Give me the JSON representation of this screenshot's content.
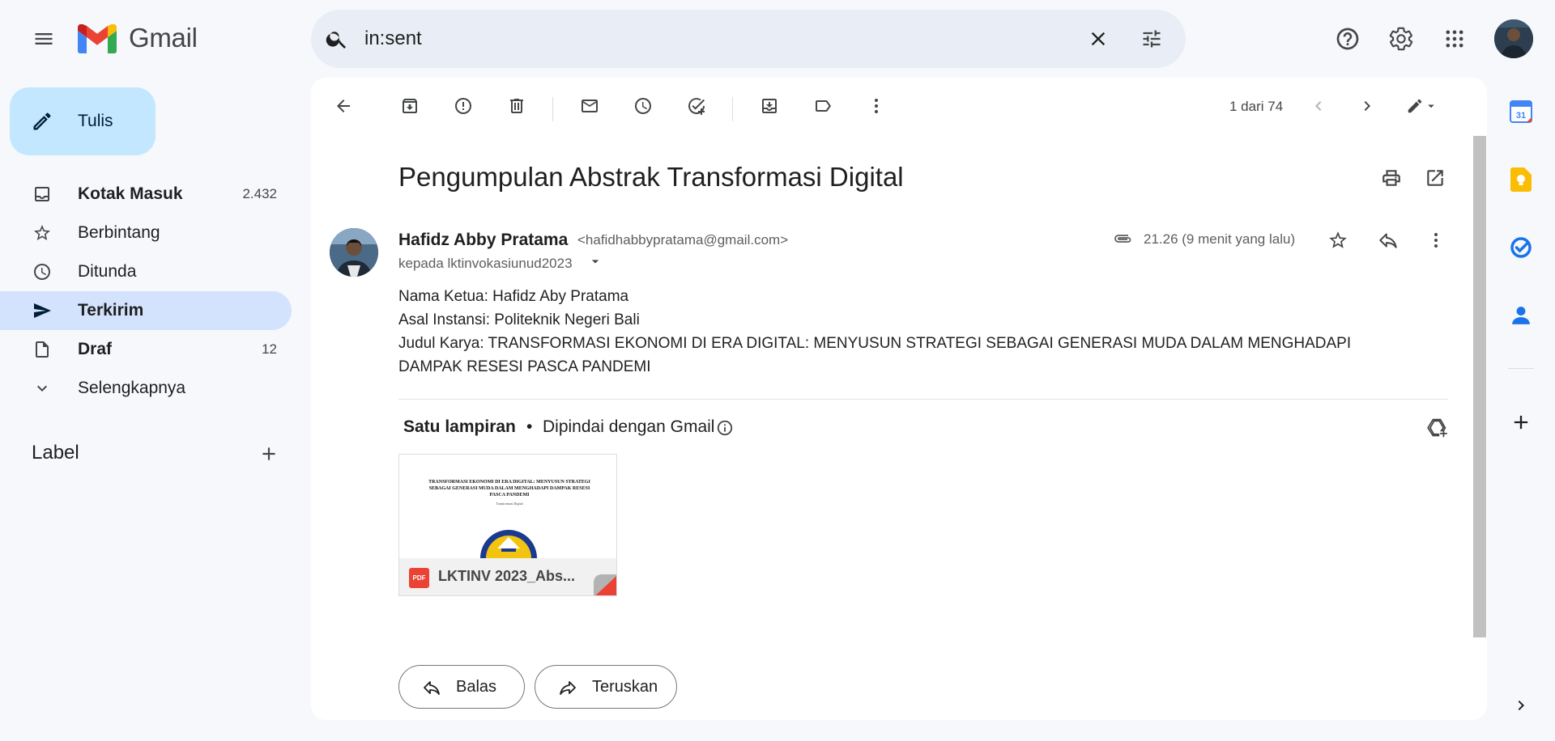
{
  "header": {
    "app_name": "Gmail",
    "search_value": "in:sent",
    "icons": [
      "menu-icon",
      "search-icon",
      "clear-icon",
      "tune-icon",
      "help-icon",
      "settings-icon",
      "apps-icon",
      "avatar"
    ]
  },
  "sidebar": {
    "compose_label": "Tulis",
    "items": [
      {
        "label": "Kotak Masuk",
        "count": "2.432",
        "bold": true,
        "icon": "inbox-icon"
      },
      {
        "label": "Berbintang",
        "count": "",
        "bold": false,
        "icon": "star-icon"
      },
      {
        "label": "Ditunda",
        "count": "",
        "bold": false,
        "icon": "clock-icon"
      },
      {
        "label": "Terkirim",
        "count": "",
        "bold": true,
        "selected": true,
        "icon": "send-icon"
      },
      {
        "label": "Draf",
        "count": "12",
        "bold": true,
        "icon": "draft-icon"
      },
      {
        "label": "Selengkapnya",
        "count": "",
        "bold": false,
        "icon": "chevron-down-icon"
      }
    ],
    "label_heading": "Label"
  },
  "toolbar": {
    "page_count": "1 dari 74"
  },
  "email": {
    "subject": "Pengumpulan Abstrak Transformasi Digital",
    "sender_name": "Hafidz Abby Pratama",
    "sender_email": "<hafidhabbypratama@gmail.com>",
    "recipient": "kepada lktinvokasiunud2023",
    "time": "21.26 (9 menit yang lalu)",
    "body_lines": [
      "Nama Ketua: Hafidz Aby Pratama",
      "Asal Instansi: Politeknik Negeri Bali",
      "Judul Karya:  TRANSFORMASI EKONOMI DI ERA DIGITAL: MENYUSUN STRATEGI SEBAGAI GENERASI MUDA DALAM MENGHADAPI",
      "DAMPAK RESESI PASCA PANDEMI"
    ]
  },
  "attachments": {
    "title": "Satu lampiran",
    "dot": "•",
    "scanned": "Dipindai dengan Gmail",
    "file": {
      "badge": "PDF",
      "name": "LKTINV 2023_Abs...",
      "thumb_title": "TRANSFORMASI EKONOMI DI ERA DIGITAL: MENYUSUN STRATEGI SEBAGAI GENERASI MUDA DALAM MENGHADAPI DAMPAK RESESI PASCA PANDEMI",
      "thumb_sub": "Transformasi Digital"
    }
  },
  "actions": {
    "reply": "Balas",
    "forward": "Teruskan"
  },
  "side_panel": {
    "calendar_day": "31"
  },
  "colors": {
    "selected_nav": "#d3e3fd",
    "compose_bg": "#c2e7ff",
    "page_bg": "#f6f8fc"
  }
}
